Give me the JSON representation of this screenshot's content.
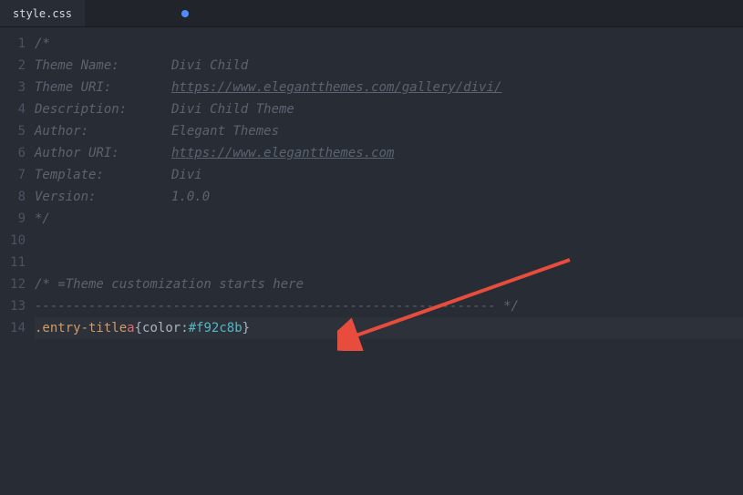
{
  "tabs": {
    "active": "style.css",
    "others": [
      "",
      "",
      "",
      "",
      "",
      "",
      "",
      ""
    ]
  },
  "gutter": {
    "l1": "1",
    "l2": "2",
    "l3": "3",
    "l4": "4",
    "l5": "5",
    "l6": "6",
    "l7": "7",
    "l8": "8",
    "l9": "9",
    "l10": "10",
    "l11": "11",
    "l12": "12",
    "l13": "13",
    "l14": "14"
  },
  "code": {
    "l1": "/*",
    "l2_label": " Theme Name:",
    "l2_value": "Divi Child",
    "l3_label": " Theme URI:",
    "l3_value": "https://www.elegantthemes.com/gallery/divi/",
    "l4_label": " Description:",
    "l4_value": "Divi Child Theme",
    "l5_label": " Author:",
    "l5_value": "Elegant Themes",
    "l6_label": " Author URI:",
    "l6_value": "https://www.elegantthemes.com",
    "l7_label": " Template:",
    "l7_value": "Divi",
    "l8_label": " Version:",
    "l8_value": "1.0.0",
    "l9": "*/",
    "l12": "/* =Theme customization starts here",
    "l13": "------------------------------------------------------------ */",
    "l14_selector": ".entry-title",
    "l14_tag": " a ",
    "l14_brace_open": "{",
    "l14_prop": "color",
    "l14_colon": ": ",
    "l14_value": "#f92c8b",
    "l14_brace_close": "}"
  }
}
